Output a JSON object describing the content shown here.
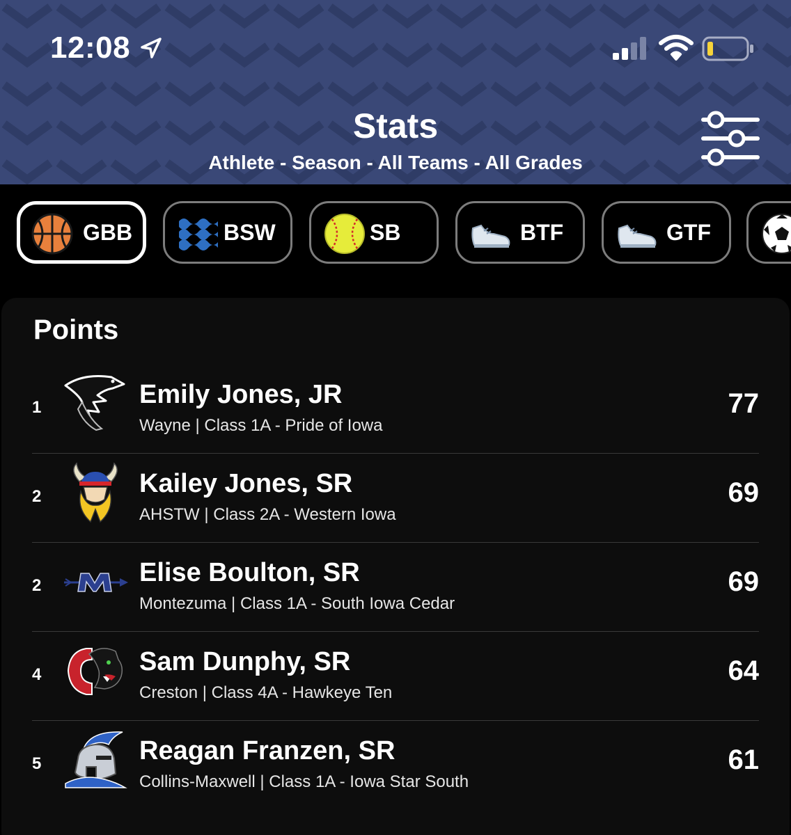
{
  "status_bar": {
    "time": "12:08",
    "icons": [
      "location-arrow-icon",
      "cellular-signal-icon",
      "wifi-icon",
      "battery-low-icon"
    ]
  },
  "header": {
    "title": "Stats",
    "subtitle": "Athlete - Season - All Teams - All Grades",
    "filter_icon": "filter-sliders-icon"
  },
  "sports": [
    {
      "label": "GBB",
      "icon": "basketball-icon",
      "active": true
    },
    {
      "label": "BSW",
      "icon": "waves-icon",
      "active": false
    },
    {
      "label": "SB",
      "icon": "softball-icon",
      "active": false
    },
    {
      "label": "BTF",
      "icon": "running-shoe-icon",
      "active": false
    },
    {
      "label": "GTF",
      "icon": "running-shoe-icon",
      "active": false
    },
    {
      "label": "",
      "icon": "soccer-ball-icon",
      "active": false
    }
  ],
  "leaderboard": {
    "title": "Points",
    "rows": [
      {
        "rank": "1",
        "name": "Emily Jones, JR",
        "detail": "Wayne | Class 1A - Pride of Iowa",
        "value": "77",
        "logo": "falcon-logo"
      },
      {
        "rank": "2",
        "name": "Kailey Jones, SR",
        "detail": "AHSTW | Class 2A - Western Iowa",
        "value": "69",
        "logo": "viking-logo"
      },
      {
        "rank": "2",
        "name": "Elise Boulton, SR",
        "detail": "Montezuma | Class 1A - South Iowa Cedar",
        "value": "69",
        "logo": "spear-m-logo"
      },
      {
        "rank": "4",
        "name": "Sam Dunphy, SR",
        "detail": "Creston | Class 4A - Hawkeye Ten",
        "value": "64",
        "logo": "panther-logo"
      },
      {
        "rank": "5",
        "name": "Reagan Franzen, SR",
        "detail": "Collins-Maxwell | Class 1A - Iowa Star South",
        "value": "61",
        "logo": "spartan-logo"
      }
    ]
  },
  "colors": {
    "header_bg": "#3a4877",
    "background": "#000000",
    "card_bg": "#0d0d0d"
  }
}
